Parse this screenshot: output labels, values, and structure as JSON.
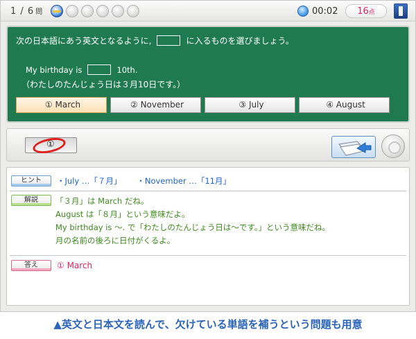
{
  "topbar": {
    "progress": "1 / 6",
    "progress_unit": "問",
    "dots_total": 6,
    "dots_active": 1,
    "timer": "00:02",
    "score_value": "16",
    "score_unit": "点"
  },
  "question": {
    "instruction_before": "次の日本語にあう英文となるように,",
    "instruction_after": "に入るものを選びましょう。",
    "english_before": "My birthday is",
    "english_after": "10th.",
    "japanese": "（わたしのたんじょう日は３月10日です。）",
    "choices": [
      "① March",
      "② November",
      "③ July",
      "④ August"
    ],
    "selected_index": 0
  },
  "answer_input": {
    "value": "①"
  },
  "explanation": {
    "hint_label": "ヒント",
    "hint_items": [
      "・July …「７月」",
      "・November …「11月」"
    ],
    "expl_label": "解説",
    "expl_lines": [
      "「３月」は March だね。",
      "August は「８月」という意味だよ。",
      "My birthday is ～. で「わたしのたんじょう日は～です。」という意味だね。",
      "月の名前の後ろに日付がくるよ。"
    ],
    "answer_label": "答え",
    "answer_text": "① March"
  },
  "caption": "▲英文と日本文を読んで、欠けている単語を補うという問題も用意",
  "colors": {
    "panel_green": "#1f7a4f",
    "hint_blue": "#1f63c7",
    "explain_green": "#3d8a1d",
    "answer_pink": "#e0245e",
    "caption_blue": "#2a63b8"
  },
  "icons": {
    "timer": "globe-clock-icon",
    "exit": "door-exit-icon",
    "next": "next-page-icon",
    "help": "help-icon",
    "wrong": "wrong-circle-mark"
  }
}
